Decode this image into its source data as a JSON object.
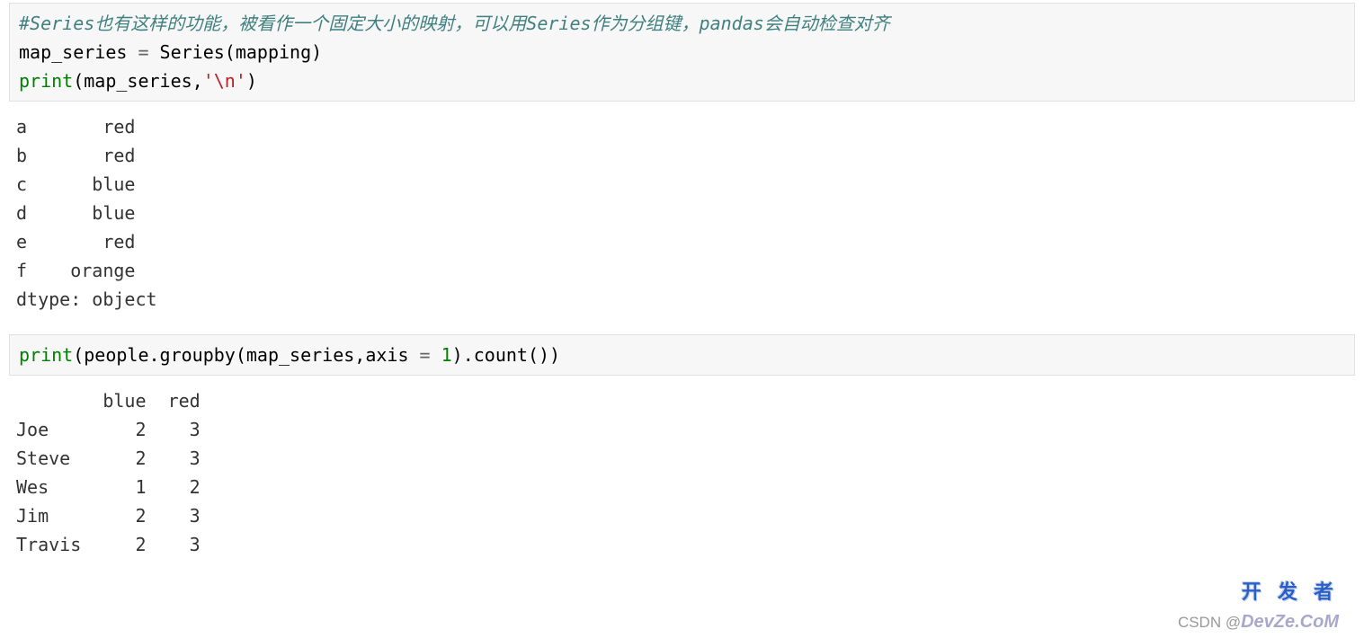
{
  "cell1": {
    "comment": "#Series也有这样的功能，被看作一个固定大小的映射，可以用Series作为分组键，pandas会自动检查对齐",
    "line2_a": "map_series ",
    "line2_eq": "=",
    "line2_b": " Series(mapping)",
    "line3_fn": "print",
    "line3_a": "(map_series,",
    "line3_str": "'\\n'",
    "line3_b": ")"
  },
  "output1": "a       red\nb       red\nc      blue\nd      blue\ne       red\nf    orange\ndtype: object \n",
  "cell2": {
    "fn": "print",
    "a": "(people.groupby(map_series,axis ",
    "eq": "=",
    "sp": " ",
    "num": "1",
    "b": ").count())"
  },
  "output2": "        blue  red\nJoe        2    3\nSteve      2    3\nWes        1    2\nJim        2    3\nTravis     2    3",
  "watermark": {
    "top": "开 发 者",
    "bottom_prefix": "CSDN @",
    "bottom_brand": "DevZe.CoM"
  }
}
